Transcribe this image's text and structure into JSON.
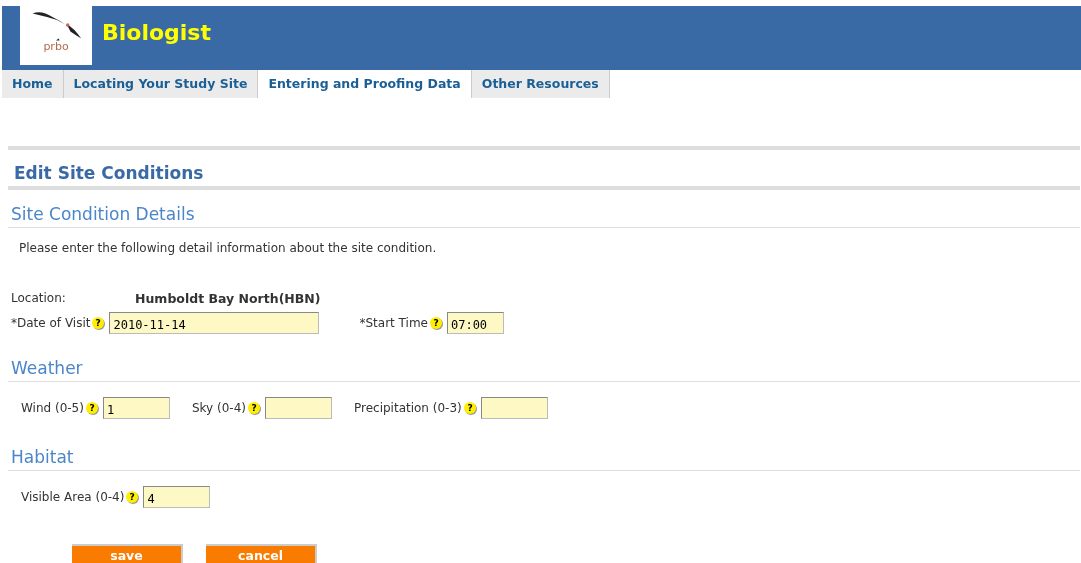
{
  "header": {
    "logo_text": "prbo",
    "title": "Biologist"
  },
  "tabs": [
    {
      "label": "Home",
      "selected": false
    },
    {
      "label": "Locating Your Study Site",
      "selected": false
    },
    {
      "label": "Entering and Proofing Data",
      "selected": true
    },
    {
      "label": "Other Resources",
      "selected": false
    }
  ],
  "page_title": "Edit Site Conditions",
  "details": {
    "heading": "Site Condition Details",
    "intro": "Please enter the following detail information about the site condition.",
    "location": {
      "label": "Location:",
      "value": "Humboldt Bay North(HBN)"
    },
    "fields": [
      {
        "label": "*Date of Visit",
        "help": "?",
        "value": "2010-11-14",
        "kind": "date"
      },
      {
        "label": "*Start Time",
        "help": "?",
        "value": "07:00",
        "kind": "time"
      }
    ]
  },
  "weather": {
    "heading": "Weather",
    "fields": [
      {
        "label": "Wind (0-5)",
        "help": "?",
        "value": "1",
        "kind": "number"
      },
      {
        "label": "Sky (0-4)",
        "help": "?",
        "kind": "number"
      },
      {
        "label": "Precipitation (0-3)",
        "help": "?",
        "kind": "number"
      }
    ]
  },
  "habitat": {
    "heading": "Habitat",
    "fields": [
      {
        "label": "Visible Area (0-4)",
        "help": "?",
        "value": "4",
        "kind": "number"
      }
    ]
  },
  "buttons": [
    "save",
    "cancel"
  ]
}
